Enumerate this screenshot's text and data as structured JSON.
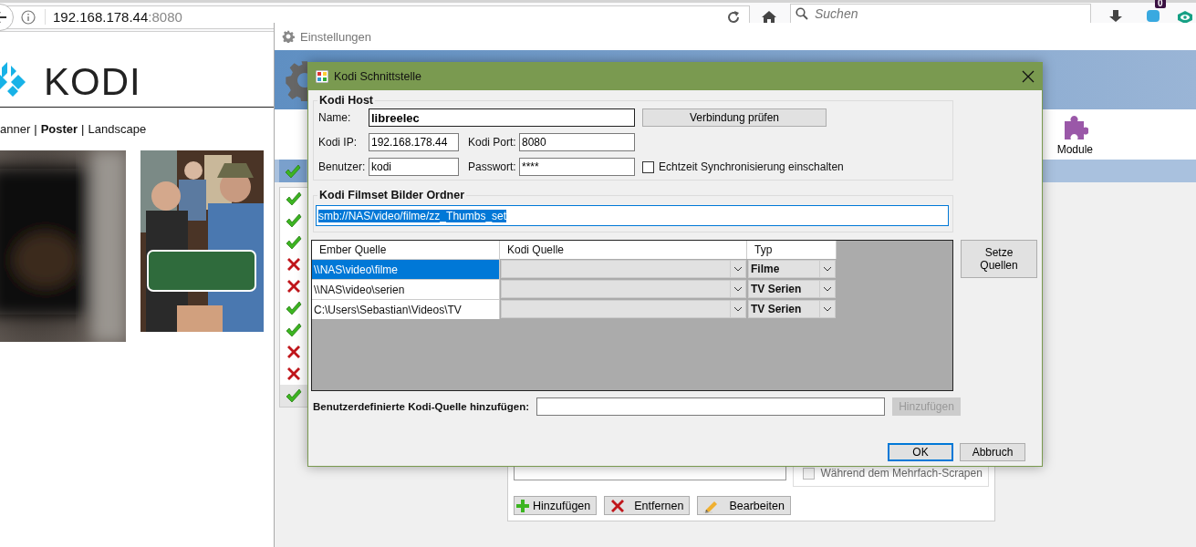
{
  "browser": {
    "url_host": "192.168.178.44",
    "url_port": ":8080",
    "search_placeholder": "Suchen",
    "badge": "0"
  },
  "page": {
    "logo_text": "KODI",
    "view_links": [
      {
        "label": "anner",
        "selected": false
      },
      {
        "label": "Poster",
        "selected": true,
        "separator": "|"
      },
      {
        "label": "Landscape",
        "selected": false,
        "separator": "|"
      }
    ]
  },
  "settings_window": {
    "title": "Einstellungen",
    "toolbar": [
      {
        "label": "Module"
      }
    ],
    "header_status": {
      "ok": true
    },
    "status_list": [
      {
        "ok": true,
        "selected": false
      },
      {
        "ok": true,
        "selected": false
      },
      {
        "ok": true,
        "selected": false
      },
      {
        "ok": false,
        "selected": false
      },
      {
        "ok": false,
        "selected": false
      },
      {
        "ok": true,
        "selected": false
      },
      {
        "ok": true,
        "selected": false
      },
      {
        "ok": false,
        "selected": false
      },
      {
        "ok": false,
        "selected": false
      },
      {
        "ok": true,
        "selected": true
      }
    ],
    "scrape_checkbox": {
      "label": "Während dem Mehrfach-Scrapen",
      "checked": false,
      "disabled": true
    },
    "buttons": [
      {
        "label": "Hinzufügen",
        "kind": "add"
      },
      {
        "label": "Entfernen",
        "kind": "remove"
      },
      {
        "label": "Bearbeiten",
        "kind": "edit"
      }
    ]
  },
  "dialog": {
    "title": "Kodi Schnittstelle",
    "host_group": {
      "legend": "Kodi Host",
      "name_label": "Name:",
      "name": "libreelec",
      "test_button": "Verbindung prüfen",
      "ip_label": "Kodi IP:",
      "ip": "192.168.178.44",
      "port_label": "Kodi Port:",
      "port": "8080",
      "user_label": "Benutzer:",
      "user": "kodi",
      "password_label": "Passwort:",
      "password": "****",
      "sync": {
        "label": "Echtzeit Synchronisierung einschalten",
        "checked": false
      }
    },
    "filmset_group": {
      "legend": "Kodi Filmset Bilder Ordner",
      "path": "smb://NAS/video/filme/zz_Thumbs_set",
      "text_selected": true
    },
    "sources_table": {
      "columns": [
        "Ember Quelle",
        "Kodi Quelle",
        "Typ"
      ],
      "rows": [
        {
          "ember": "\\\\NAS\\video\\filme",
          "type": "Filme",
          "selected": true
        },
        {
          "ember": "\\\\NAS\\video\\serien",
          "type": "TV Serien",
          "selected": false
        },
        {
          "ember": "C:\\Users\\Sebastian\\Videos\\TV",
          "type": "TV Serien",
          "selected": false
        }
      ]
    },
    "set_sources_button": "Setze Quellen",
    "custom_source": {
      "label": "Benutzerdefinierte Kodi-Quelle hinzufügen:",
      "add_button": "Hinzufügen",
      "add_disabled": true
    },
    "buttons": [
      {
        "label": "OK",
        "focused": true
      },
      {
        "label": "Abbruch",
        "focused": false
      }
    ]
  }
}
